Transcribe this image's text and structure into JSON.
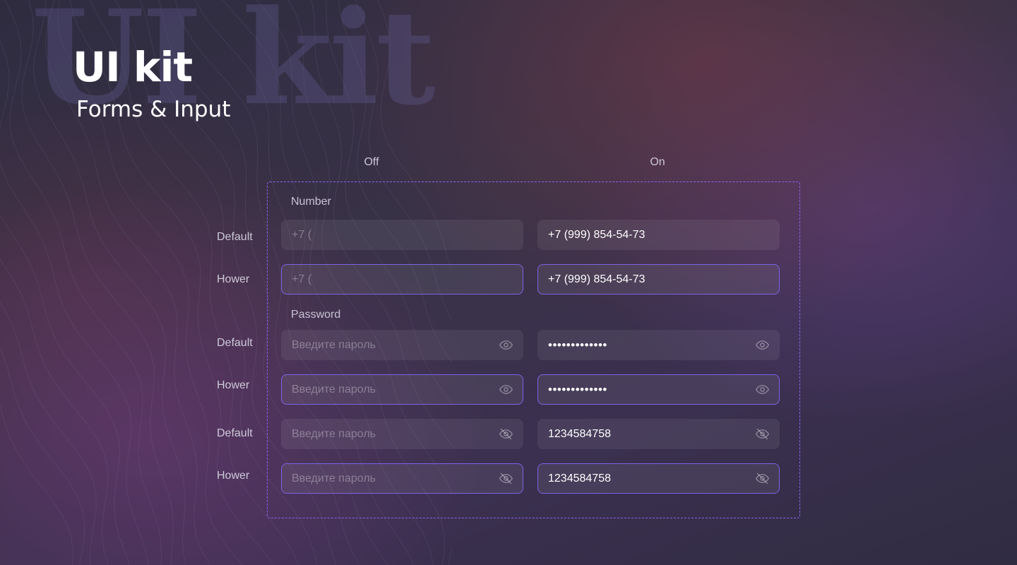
{
  "header": {
    "watermark": "UI kit",
    "title": "UI kit",
    "subtitle": "Forms & Input"
  },
  "columns": {
    "off": "Off",
    "on": "On"
  },
  "sections": {
    "number": "Number",
    "password": "Password"
  },
  "states": {
    "default": "Default",
    "hover": "Hower"
  },
  "number": {
    "off_placeholder": "+7 (",
    "on_value": "+7 (999) 854-54-73"
  },
  "password": {
    "placeholder": "Введите пароль",
    "masked_value": "•••••••••••••",
    "visible_value": "1234584758"
  },
  "icons": {
    "eye": "eye-icon",
    "eye_off": "eye-off-icon"
  },
  "colors": {
    "accent": "#8a63f2",
    "hover_border": "#7b63e6",
    "field_bg": "rgba(255,255,255,0.07)",
    "text": "#ffffff",
    "muted_text": "#cdc9d7"
  }
}
